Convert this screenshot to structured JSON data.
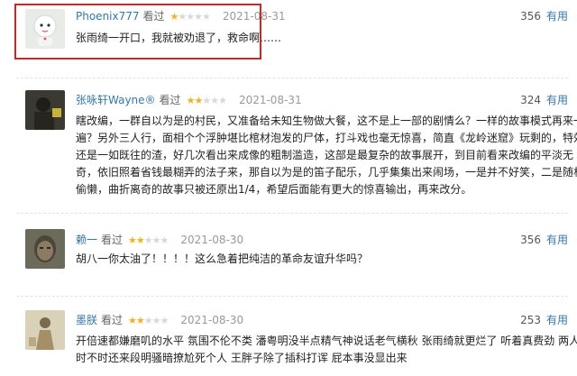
{
  "colors": {
    "star_on": "#f3b21d",
    "star_off": "#d8d8d8",
    "link": "#3377aa",
    "highlight_border": "#c62828"
  },
  "reviews": [
    {
      "username": "Phoenix777",
      "watched": "看过",
      "rating": 1,
      "max_rating": 5,
      "date": "2021-08-31",
      "votes": "356",
      "useful_label": "有用",
      "lines": [
        "张雨绮一开口，我就被劝退了，救命啊……"
      ],
      "avatar_icon": "white-doll-avatar"
    },
    {
      "username": "张咏轩Wayne®",
      "watched": "看过",
      "rating": 2,
      "max_rating": 5,
      "date": "2021-08-31",
      "votes": "324",
      "useful_label": "有用",
      "lines": [
        "瞎改编，一群自以为是的村民，又准备给未知生物做大餐，这不是上一部的剧情么？一样的故事模式再来一",
        "遍？另外三人行，面相个个浮肿堪比棺材泡发的尸体，打斗戏也毫无惊喜，简直《龙岭迷窟》玩剩的，特效",
        "还是一如既往的渣，好几次看出来成像的粗制滥造，这部是最复杂的故事展开，到目前看来改编的平淡无",
        "奇，依旧照着省钱最糊弄的法子来，那自以为是的笛子配乐，几乎集集出来闹场，一是并不好笑，二是随机",
        "偷懒，曲折离奇的故事只被还原出1/4，希望后面能有更大的惊喜输出，再来改分。"
      ],
      "avatar_icon": "dark-person-avatar"
    },
    {
      "username": "赖一",
      "watched": "看过",
      "rating": 2,
      "max_rating": 5,
      "date": "2021-08-30",
      "votes": "356",
      "useful_label": "有用",
      "lines": [
        "胡八一你太油了！！！！这么急着把纯洁的革命友谊升华吗？"
      ],
      "avatar_icon": "face-avatar"
    },
    {
      "username": "墨朕",
      "watched": "看过",
      "rating": 2,
      "max_rating": 5,
      "date": "2021-08-30",
      "votes": "253",
      "useful_label": "有用",
      "lines": [
        "开倍速都嫌磨叽的水平 氛围不伦不类 潘粤明没半点精气神说话老气横秋 张雨绮就更烂了 听着真费劲 两人",
        "时不时还来段明骚暗撩尬死个人 王胖子除了插科打诨 屁本事没显出来"
      ],
      "avatar_icon": "figure-avatar"
    }
  ]
}
